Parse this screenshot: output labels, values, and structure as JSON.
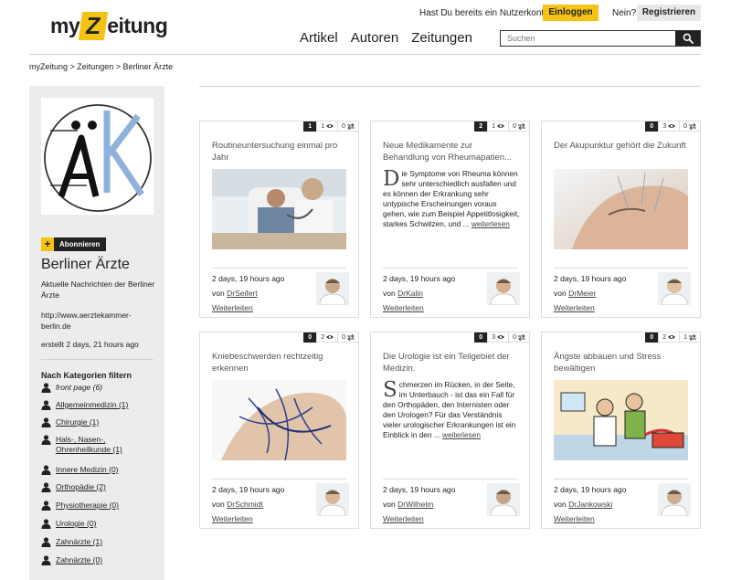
{
  "brand": {
    "logo_pre": "my",
    "logo_z": "Z",
    "logo_post": "eitung",
    "accent": "#f5c313"
  },
  "account": {
    "question": "Hast Du bereits ein Nutzerkonto?",
    "login_label": "Einloggen",
    "nein": "Nein?",
    "register_label": "Registrieren"
  },
  "nav": {
    "artikel": "Artikel",
    "autoren": "Autoren",
    "zeitungen": "Zeitungen"
  },
  "search": {
    "placeholder": "Suchen",
    "icon": "search-icon"
  },
  "breadcrumb": "myZeitung > Zeitungen > Berliner Ärzte",
  "sidebar": {
    "subscribe_plus": "+",
    "subscribe_label": "Abonnieren",
    "title": "Berliner Ärzte",
    "description": "Aktuelle Nachrichten der Berliner Ärzte",
    "url": "http://www.aerztekammer-berlin.de",
    "created": "erstellt 2 days, 21 hours ago",
    "filter_title": "Nach Kategorien filtern",
    "categories": [
      {
        "label": "front page (6)"
      },
      {
        "label": "Allgemeinmedizin (1)"
      },
      {
        "label": "Chirurgie (1)"
      },
      {
        "label": "Hals-, Nasen-, Ohrenheilkunde (1)"
      },
      {
        "label": "Innere Medizin (0)"
      },
      {
        "label": "Orthopädie (2)"
      },
      {
        "label": "Physiotherapie (0)"
      },
      {
        "label": "Urologie (0)"
      },
      {
        "label": "Zahnärzte (1)"
      },
      {
        "label": "Zahnärzte (0)"
      }
    ]
  },
  "cards": [
    {
      "rank": "1",
      "views": "1",
      "shares": "0",
      "title": "Routineuntersuchung einmal pro Jahr",
      "time": "2 days, 19 hours ago",
      "by": "von",
      "author": "DrSeifert",
      "share": "Weiterleiten"
    },
    {
      "rank": "2",
      "views": "1",
      "shares": "0",
      "title": "Neue Medikamente zur Behandlung von Rheumapatien...",
      "dropcap": "D",
      "text": "ie Symptome von Rheuma können sehr unterschiedlich ausfallen und es können der Erkrankung sehr untypische Erscheinungen voraus gehen, wie zum Beispiel Appetitlosigkeit, starkes Schwitzen, und ... ",
      "more": "weiterlesen",
      "time": "2 days, 19 hours ago",
      "by": "von",
      "author": "DrKalin",
      "share": "Weiterleiten"
    },
    {
      "rank": "0",
      "views": "3",
      "shares": "0",
      "title": "Der Akupunktur gehört die Zukunft",
      "time": "2 days, 19 hours ago",
      "by": "von",
      "author": "DrMeier",
      "share": "Weiterleiten"
    },
    {
      "rank": "0",
      "views": "2",
      "shares": "0",
      "title": "Kniebeschwerden rechtzeitig erkennen",
      "time": "2 days, 19 hours ago",
      "by": "von",
      "author": "DrSchmidt",
      "share": "Weiterleiten"
    },
    {
      "rank": "0",
      "views": "3",
      "shares": "0",
      "title": "Die Urologie ist ein Teilgebiet der Medizin.",
      "dropcap": "S",
      "text": "chmerzen im Rücken, in der Seite, im Unterbauch - ist das ein Fall für den Orthopäden, den Internisten oder den Urologen? Für das Verständnis vieler urologischer Erkrankungen ist ein Einblick in den ... ",
      "more": "weiterlesen",
      "time": "2 days, 19 hours ago",
      "by": "von",
      "author": "DrWilhelm",
      "share": "Weiterleiten"
    },
    {
      "rank": "0",
      "views": "2",
      "shares": "1",
      "title": "Ängste abbauen und Stress bewältigen",
      "time": "2 days, 19 hours ago",
      "by": "von",
      "author": "DrJankowski",
      "share": "Weiterleiten"
    }
  ]
}
